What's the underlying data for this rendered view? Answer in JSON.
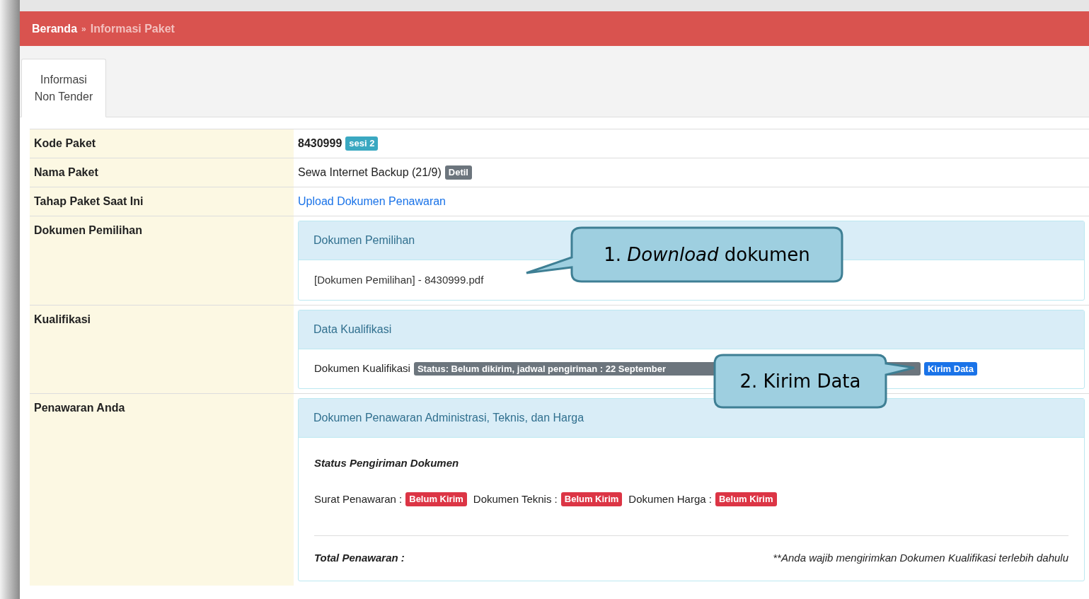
{
  "breadcrumb": [
    {
      "label": "Beranda",
      "current": false
    },
    {
      "label": "Informasi Paket",
      "current": true
    }
  ],
  "breadcrumb_separator": "»",
  "tabs": [
    {
      "label": "Informasi Non Tender",
      "selected": true
    }
  ],
  "rows": [
    {
      "kind": "code",
      "label": "Kode Paket",
      "value": "8430999",
      "badge": "sesi 2"
    },
    {
      "kind": "name",
      "label": "Nama Paket",
      "value": "Sewa Internet Backup (21/9)",
      "badge": "Detil"
    },
    {
      "kind": "link",
      "label": "Tahap Paket Saat Ini",
      "value": "Upload Dokumen Penawaran"
    },
    {
      "kind": "docs",
      "label": "Dokumen Pemilihan",
      "panel_title": "Dokumen Pemilihan",
      "item": "[Dokumen Pemilihan] - 8430999.pdf"
    },
    {
      "kind": "qual",
      "label": "Kualifikasi",
      "panel_title": "Data Kualifikasi",
      "item": "Dokumen Kualifikasi",
      "status": "Status: Belum dikirim, jadwal pengiriman : 22 September",
      "button": "Kirim Data"
    },
    {
      "kind": "offer",
      "label": "Penawaran Anda",
      "panel_title": "Dokumen Penawaran Administrasi, Teknis, dan Harga",
      "status_heading": "Status Pengiriman Dokumen",
      "statuses": [
        {
          "label": "Surat Penawaran :",
          "badge": "Belum Kirim"
        },
        {
          "label": "Dokumen Teknis :",
          "badge": "Belum Kirim"
        },
        {
          "label": "Dokumen Harga :",
          "badge": "Belum Kirim"
        }
      ],
      "total_label": "Total Penawaran :",
      "note": "**Anda wajib mengirimkan Dokumen Kualifikasi terlebih dahulu"
    }
  ],
  "callouts": [
    "1. *Download* dokumen",
    "2. Kirim Data"
  ]
}
